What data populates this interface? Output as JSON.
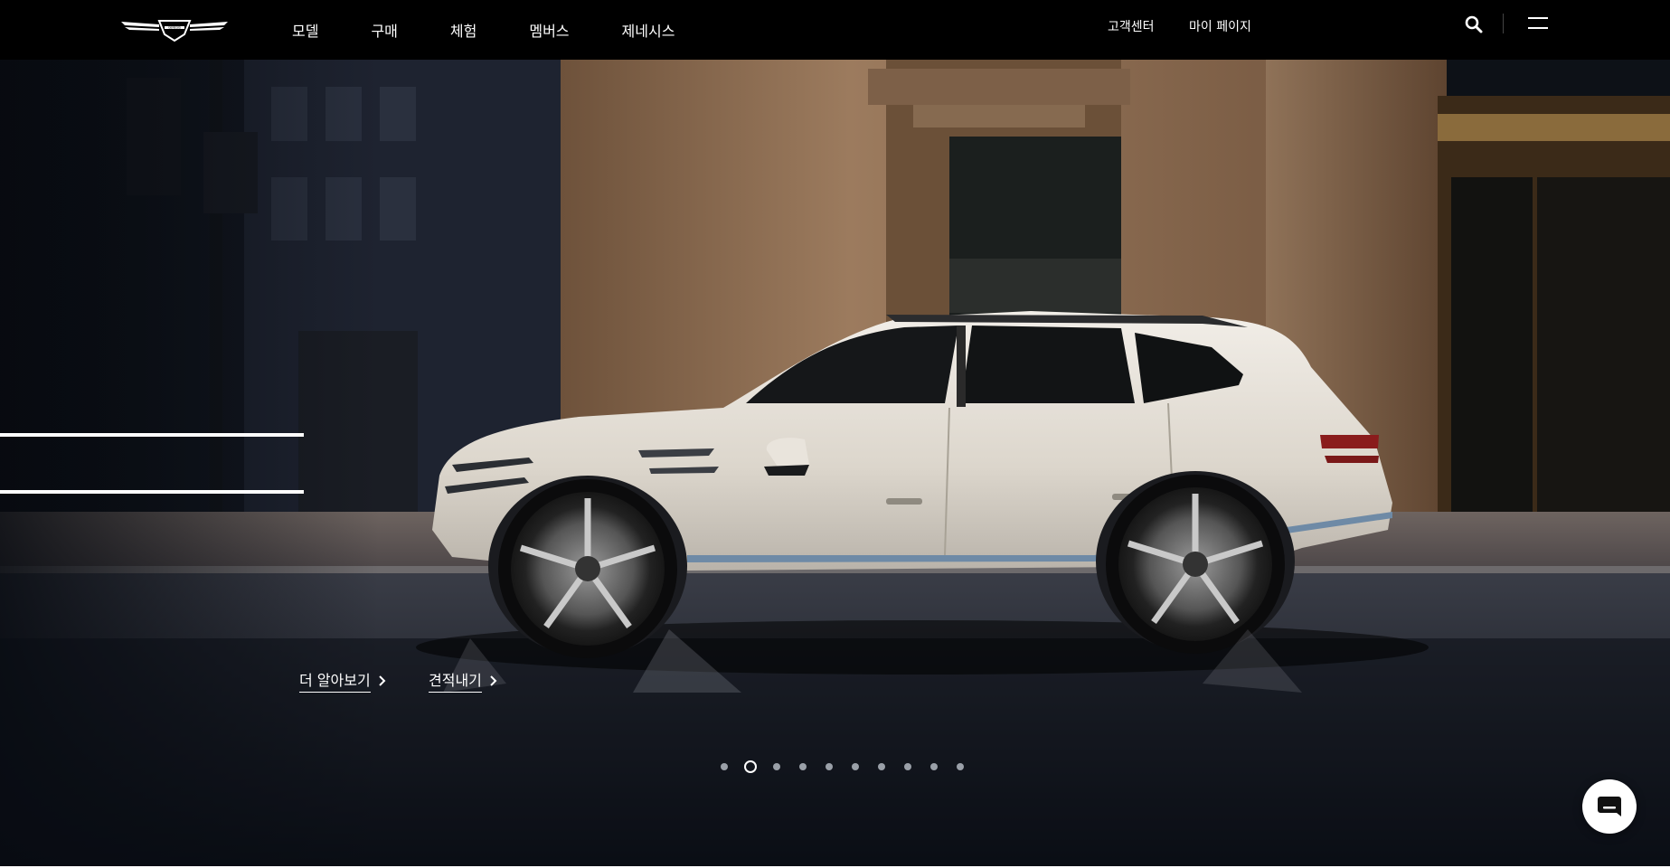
{
  "brand": {
    "logo_text": "GENESIS"
  },
  "header": {
    "nav": [
      "모델",
      "구매",
      "체험",
      "멤버스",
      "제네시스"
    ],
    "customer_center": "고객센터",
    "my_page": "마이 페이지"
  },
  "hero": {
    "learn_more": "더 알아보기",
    "get_quote": "견적내기",
    "slides_total": 10,
    "slide_active_index": 2
  },
  "colors": {
    "header_bg": "#000000",
    "accent": "#ffffff",
    "car_body": "#e9e4dc",
    "building_stone": "#8a6a4c"
  }
}
